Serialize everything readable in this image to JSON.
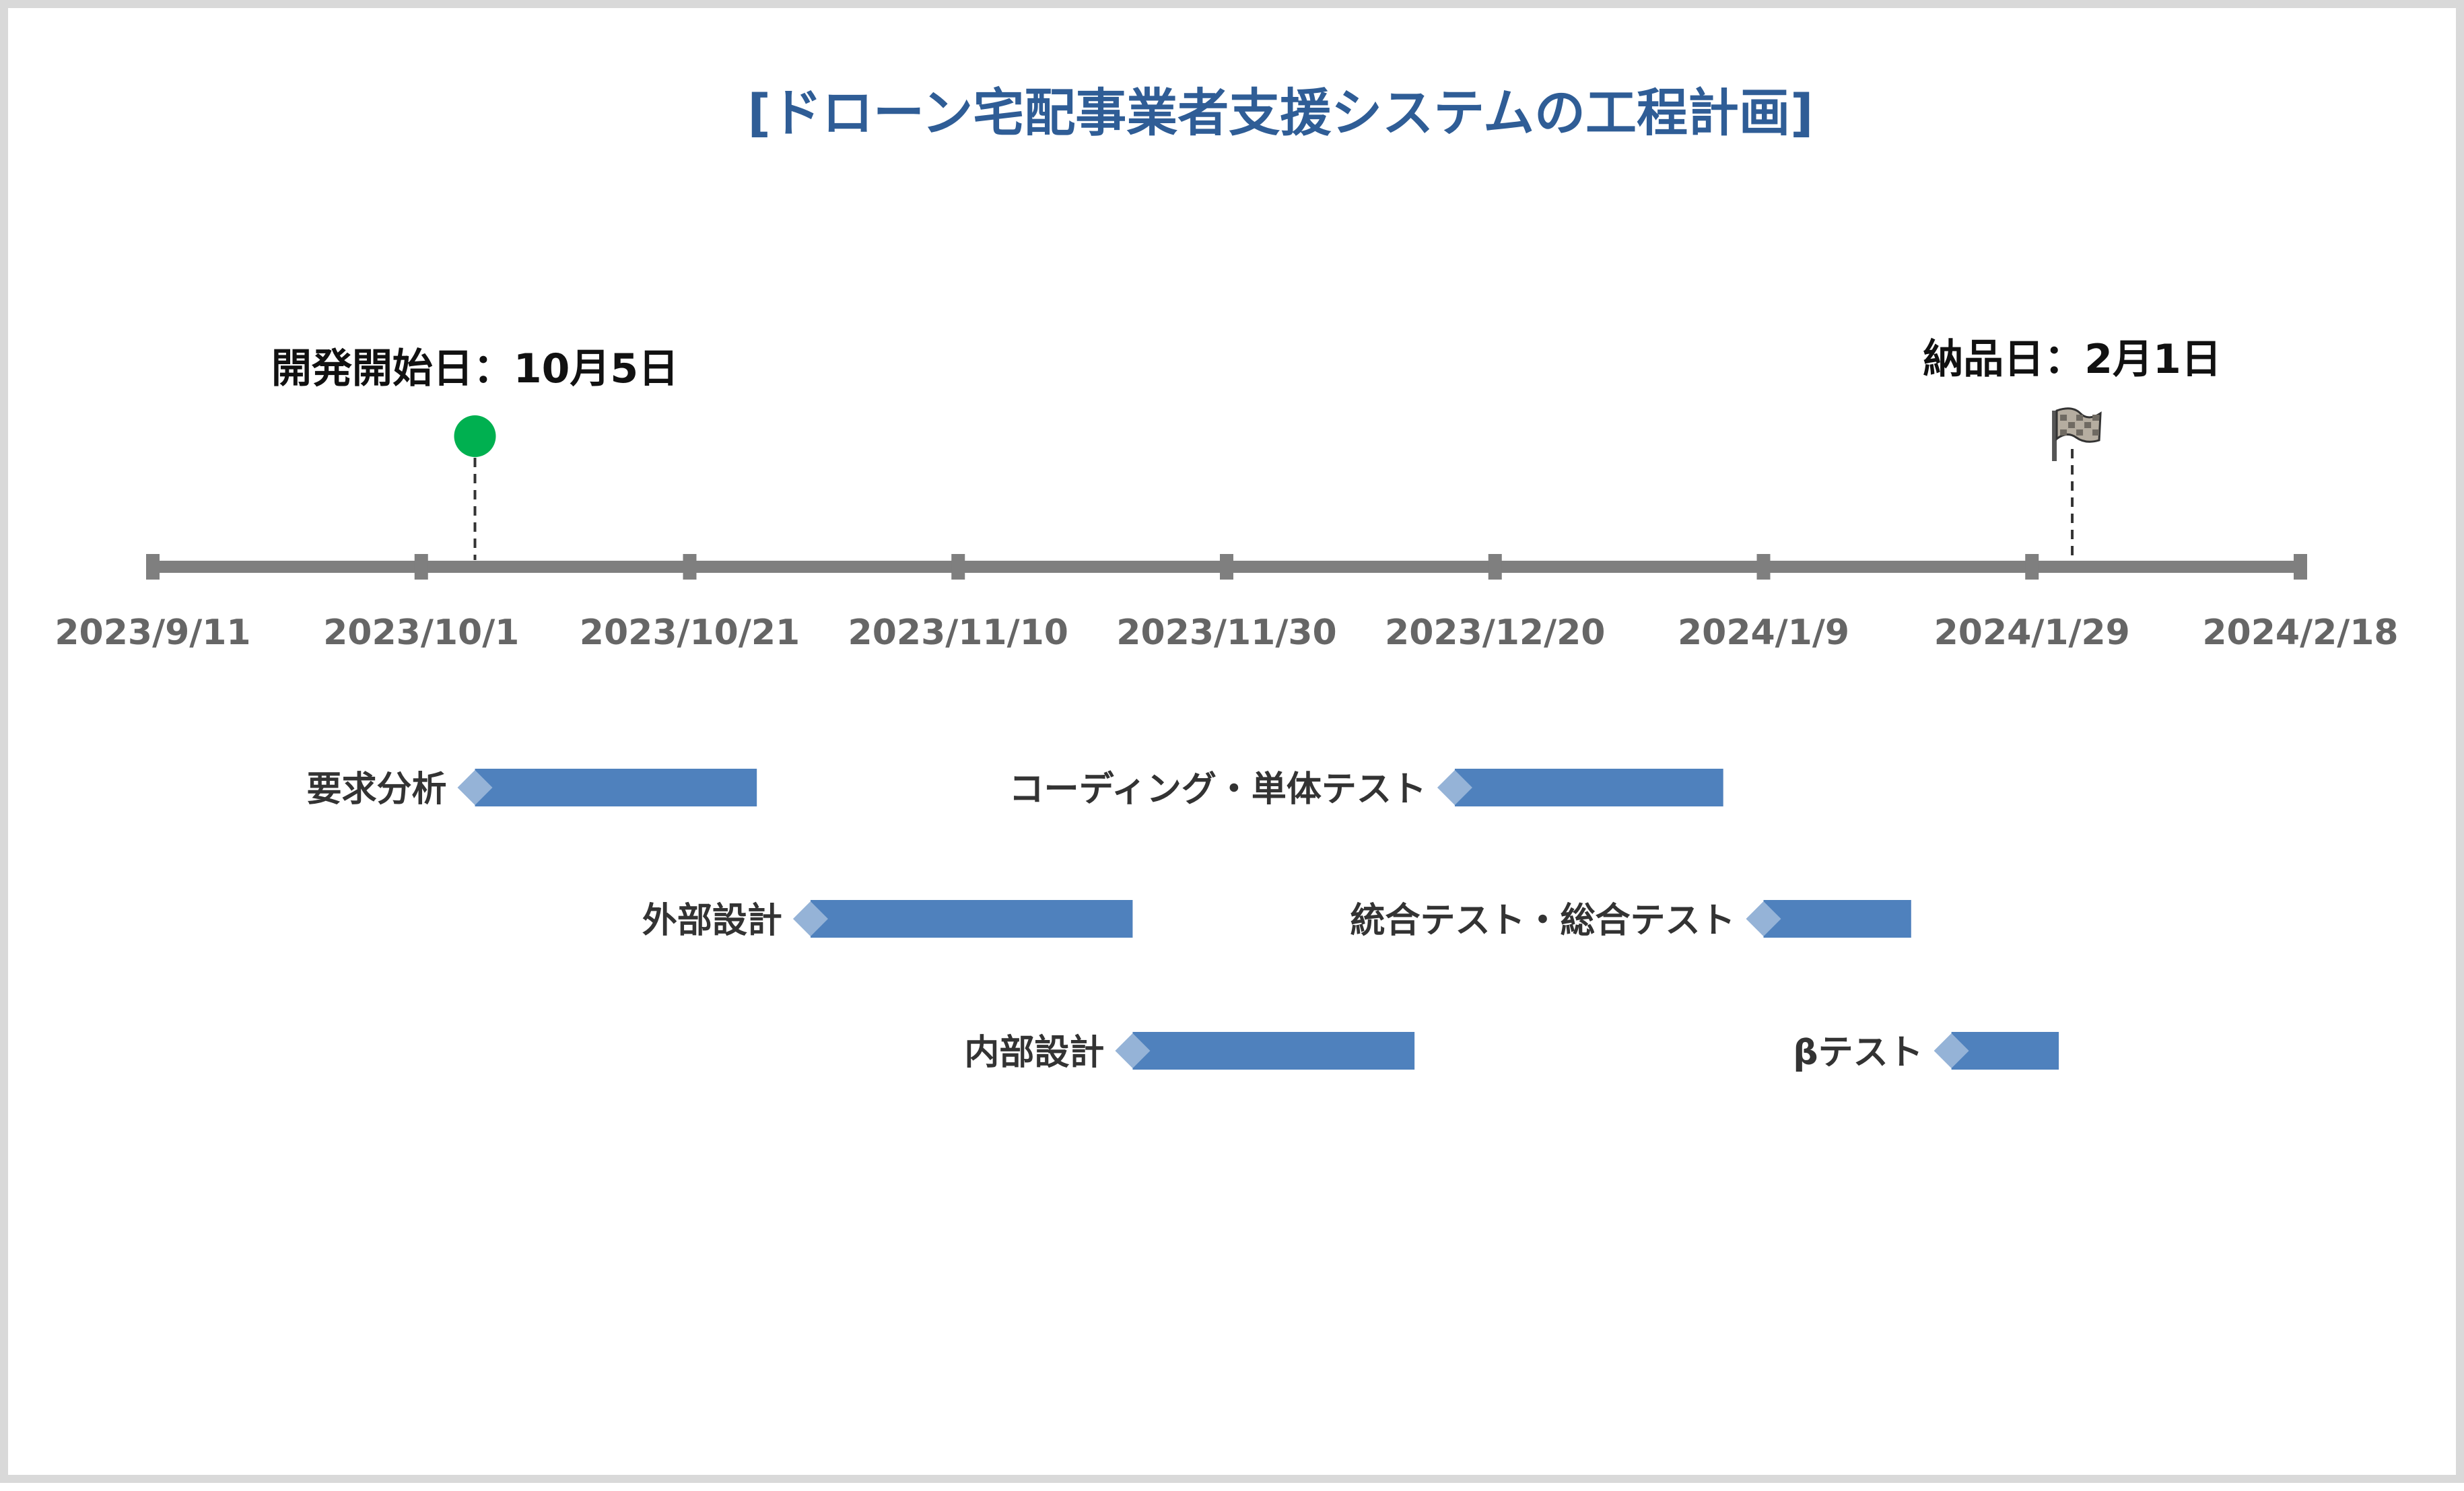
{
  "chart_data": {
    "type": "timeline",
    "title": "[ドローン宅配事業者支援システムの工程計画]",
    "x_axis": {
      "type": "date",
      "range": [
        "2023-09-11",
        "2024-02-18"
      ],
      "tick_labels": [
        "2023/9/11",
        "2023/10/1",
        "2023/10/21",
        "2023/11/10",
        "2023/11/30",
        "2023/12/20",
        "2024/1/9",
        "2024/1/29",
        "2024/2/18"
      ]
    },
    "milestones": [
      {
        "label": "開発開始日：10月5日",
        "date": "2023-10-05",
        "marker": "green-circle",
        "color": "#00b050"
      },
      {
        "label": "納品日：2月1日",
        "date": "2024-02-01",
        "marker": "checkered-flag-icon"
      }
    ],
    "tasks": [
      {
        "name": "要求分析",
        "start": "2023-10-05",
        "end": "2023-10-26",
        "row": 1
      },
      {
        "name": "外部設計",
        "start": "2023-10-30",
        "end": "2023-11-23",
        "row": 2
      },
      {
        "name": "内部設計",
        "start": "2023-11-23",
        "end": "2023-12-14",
        "row": 3
      },
      {
        "name": "コーディング・単体テスト",
        "start": "2023-12-17",
        "end": "2024-01-06",
        "row": 1
      },
      {
        "name": "統合テスト・総合テスト",
        "start": "2024-01-09",
        "end": "2024-01-20",
        "row": 2
      },
      {
        "name": "βテスト",
        "start": "2024-01-23",
        "end": "2024-01-31",
        "row": 3
      }
    ],
    "colors": {
      "title": "#2f5d96",
      "axis": "#7f7f7f",
      "tick_label": "#666666",
      "bar": "#4f81bd",
      "bar_start_diamond": "#95b3d7",
      "milestone_start": "#00b050"
    },
    "grid": false,
    "legend": "none"
  }
}
